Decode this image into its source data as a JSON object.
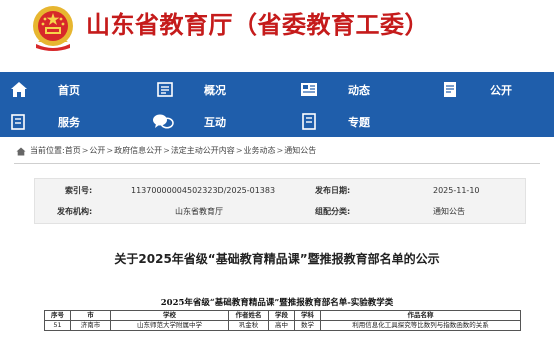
{
  "header": {
    "site_title": "山东省教育厅（省委教育工委）",
    "emblem_icon": "national-emblem-icon",
    "title_color": "#c51b1b"
  },
  "nav": {
    "background": "#1f5eab",
    "items": [
      {
        "label": "首页",
        "icon": "home-icon"
      },
      {
        "label": "概况",
        "icon": "profile-icon"
      },
      {
        "label": "动态",
        "icon": "news-icon"
      },
      {
        "label": "公开",
        "icon": "disclosure-icon"
      },
      {
        "label": "服务",
        "icon": "service-icon"
      },
      {
        "label": "互动",
        "icon": "chat-icon"
      },
      {
        "label": "专题",
        "icon": "topic-icon"
      }
    ]
  },
  "breadcrumb": {
    "prefix": "当前位置:",
    "items": [
      "首页",
      "公开",
      "政府信息公开",
      "法定主动公开内容",
      "业务动态",
      "通知公告"
    ],
    "separator": ">"
  },
  "meta": {
    "index_label": "索引号:",
    "index_value": "11370000004502323D/2025-01383",
    "publisher_label": "发布机构:",
    "publisher_value": "山东省教育厅",
    "date_label": "发布日期:",
    "date_value": "2025-11-10",
    "category_label": "组配分类:",
    "category_value": "通知公告"
  },
  "article": {
    "title": "关于2025年省级“基础教育精品课”暨推报教育部名单的公示"
  },
  "table": {
    "caption": "2025年省级“基础教育精品课”暨推报教育部名单-实验教学类",
    "headers": [
      "序号",
      "市",
      "学校",
      "作者姓名",
      "学段",
      "学科",
      "作品名称"
    ],
    "rows": [
      [
        "51",
        "济南市",
        "山东师范大学附属中学",
        "巩金秋",
        "高中",
        "数学",
        "利用信息化工具探究等比数列与指数函数的关系"
      ]
    ]
  }
}
